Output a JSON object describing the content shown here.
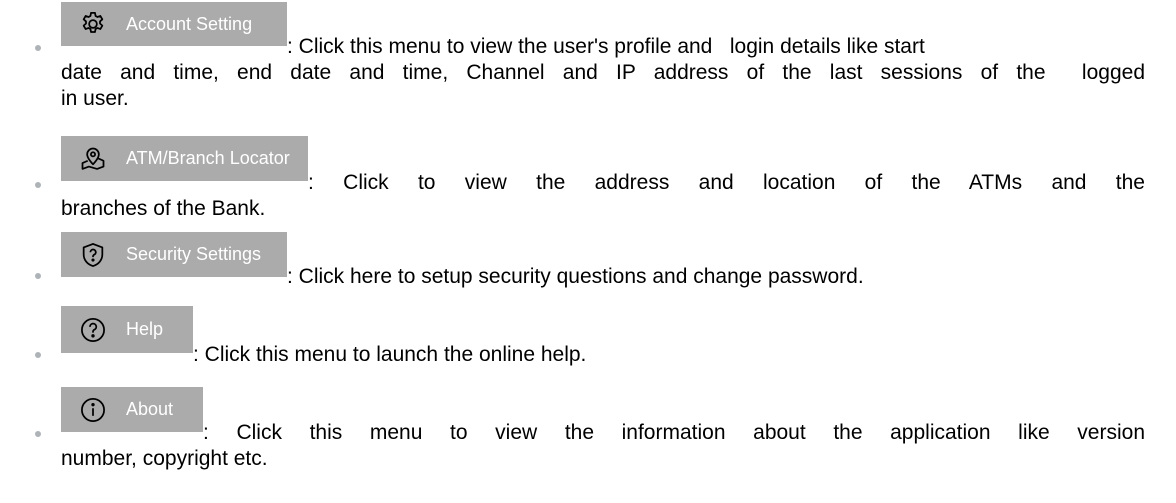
{
  "items": [
    {
      "icon": "gear-icon",
      "label": "Account Setting",
      "line1": ": Click this menu to view the user's profile and   login details like start",
      "line2": "date and time, end date and time, Channel and IP address of the last sessions of the  logged",
      "line3": "in user."
    },
    {
      "icon": "map-pin-icon",
      "label": "ATM/Branch Locator",
      "line1": ": Click to view the address and location of the ATMs and the",
      "line2": "branches of the Bank."
    },
    {
      "icon": "shield-question-icon",
      "label": "Security Settings",
      "line1": ": Click here to setup security questions and change password."
    },
    {
      "icon": "help-circle-icon",
      "label": "Help",
      "line1": ": Click this menu to launch the online help."
    },
    {
      "icon": "info-circle-icon",
      "label": "About",
      "line1": ": Click this menu to view the information about the application like version",
      "line2": "number, copyright etc."
    }
  ],
  "colors": {
    "button_bg": "#ababab",
    "button_text": "#ffffff",
    "bullet": "#aeb3b8"
  }
}
